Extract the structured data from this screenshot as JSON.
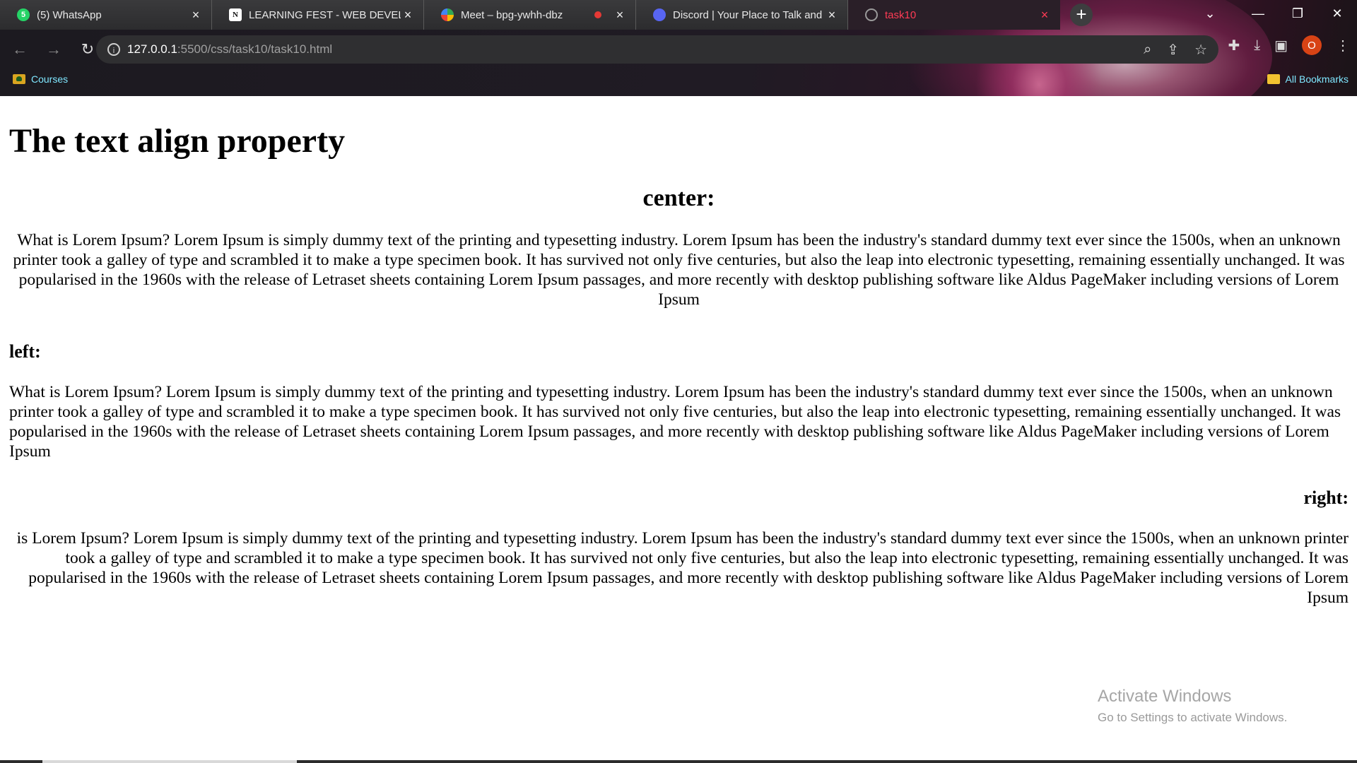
{
  "browser": {
    "tabs": [
      {
        "icon": "whatsapp-icon",
        "badge": "5",
        "title": "(5) WhatsApp",
        "close": "×"
      },
      {
        "icon": "notion-icon",
        "badge": "N",
        "title": "LEARNING FEST - WEB DEVELOP",
        "close": "×"
      },
      {
        "icon": "google-meet-icon",
        "badge": "",
        "title": "Meet – bpg-ywhh-dbz",
        "close": "×"
      },
      {
        "icon": "discord-icon",
        "badge": "",
        "title": "Discord | Your Place to Talk and",
        "close": "×"
      },
      {
        "icon": "globe-icon",
        "badge": "",
        "title": "task10",
        "close": "×"
      }
    ],
    "new_tab": "+",
    "window_controls": {
      "tab_search": "⌄",
      "minimize": "—",
      "restore": "❐",
      "close": "✕"
    },
    "nav": {
      "back": "←",
      "forward": "→",
      "reload": "↻"
    },
    "address": {
      "host": "127.0.0.1",
      "rest": ":5500/css/task10/task10.html"
    },
    "omnibox_icons": {
      "zoom": "⌕",
      "share": "⇪",
      "star": "☆"
    },
    "toolbar_icons": {
      "extensions": "✚",
      "download": "⤓",
      "sidepanel": "▣",
      "menu": "⋮"
    },
    "profile_initial": "O",
    "bookmarks": {
      "left": "Courses",
      "right": "All Bookmarks"
    }
  },
  "page": {
    "title": "The text align property",
    "sections": {
      "center_heading": "center:",
      "center_text": "What is Lorem Ipsum? Lorem Ipsum is simply dummy text of the printing and typesetting industry. Lorem Ipsum has been the industry's standard dummy text ever since the 1500s, when an unknown printer took a galley of type and scrambled it to make a type specimen book. It has survived not only five centuries, but also the leap into electronic typesetting, remaining essentially unchanged. It was popularised in the 1960s with the release of Letraset sheets containing Lorem Ipsum passages, and more recently with desktop publishing software like Aldus PageMaker including versions of Lorem Ipsum",
      "left_heading": "left:",
      "left_text": "What is Lorem Ipsum? Lorem Ipsum is simply dummy text of the printing and typesetting industry. Lorem Ipsum has been the industry's standard dummy text ever since the 1500s, when an unknown printer took a galley of type and scrambled it to make a type specimen book. It has survived not only five centuries, but also the leap into electronic typesetting, remaining essentially unchanged. It was popularised in the 1960s with the release of Letraset sheets containing Lorem Ipsum passages, and more recently with desktop publishing software like Aldus PageMaker including versions of Lorem Ipsum",
      "right_heading": "right:",
      "right_text": "is Lorem Ipsum? Lorem Ipsum is simply dummy text of the printing and typesetting industry. Lorem Ipsum has been the industry's standard dummy text ever since the 1500s, when an unknown printer took a galley of type and scrambled it to make a type specimen book. It has survived not only five centuries, but also the leap into electronic typesetting, remaining essentially unchanged. It was popularised in the 1960s with the release of Letraset sheets containing Lorem Ipsum passages, and more recently with desktop publishing software like Aldus PageMaker including versions of Lorem Ipsum"
    }
  },
  "watermark": {
    "line1": "Activate Windows",
    "line2": "Go to Settings to activate Windows."
  },
  "colors": {
    "active_tab_text": "#ff3b55",
    "bookmark_text": "#7fe7ff",
    "avatar": "#d84315"
  }
}
